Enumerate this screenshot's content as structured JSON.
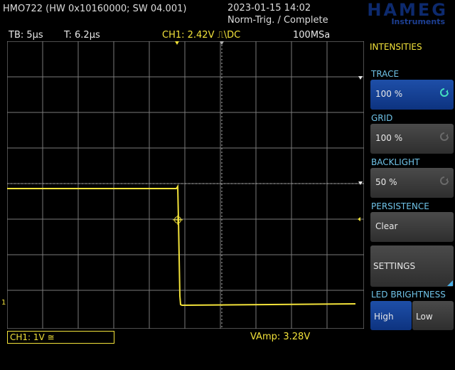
{
  "header": {
    "model": "HMO722 (HW 0x10160000; SW 04.001)",
    "datetime": "2023-01-15 14:02",
    "trigger_state": "Norm-Trig. / Complete",
    "logo_word": "HAMEG",
    "logo_sub": "Instruments"
  },
  "status": {
    "timebase": "TB: 5µs",
    "trigger_pos": "T: 6.2µs",
    "ch1": "CH1: 2.42V ⎍\\DC",
    "sample_rate": "100MSa"
  },
  "bottom": {
    "ch1_scale": "CH1: 1V ≅",
    "measurement": "VAmp: 3.28V"
  },
  "channel_marker": "1",
  "menu": {
    "title": "INTENSITIES",
    "trace": {
      "label": "TRACE",
      "value": "100 %"
    },
    "grid": {
      "label": "GRID",
      "value": "100 %"
    },
    "backlight": {
      "label": "BACKLIGHT",
      "value": "50 %"
    },
    "persistence": {
      "label": "PERSISTENCE",
      "value": "Clear"
    },
    "settings": {
      "label": "SETTINGS"
    },
    "led_brightness": {
      "label": "LED BRIGHTNESS",
      "options": [
        "High",
        "Low"
      ],
      "selected": "High"
    }
  },
  "colors": {
    "trace": "#f2e23a",
    "menu_label": "#6fc3e8",
    "active_button": "#1e4fa8"
  }
}
